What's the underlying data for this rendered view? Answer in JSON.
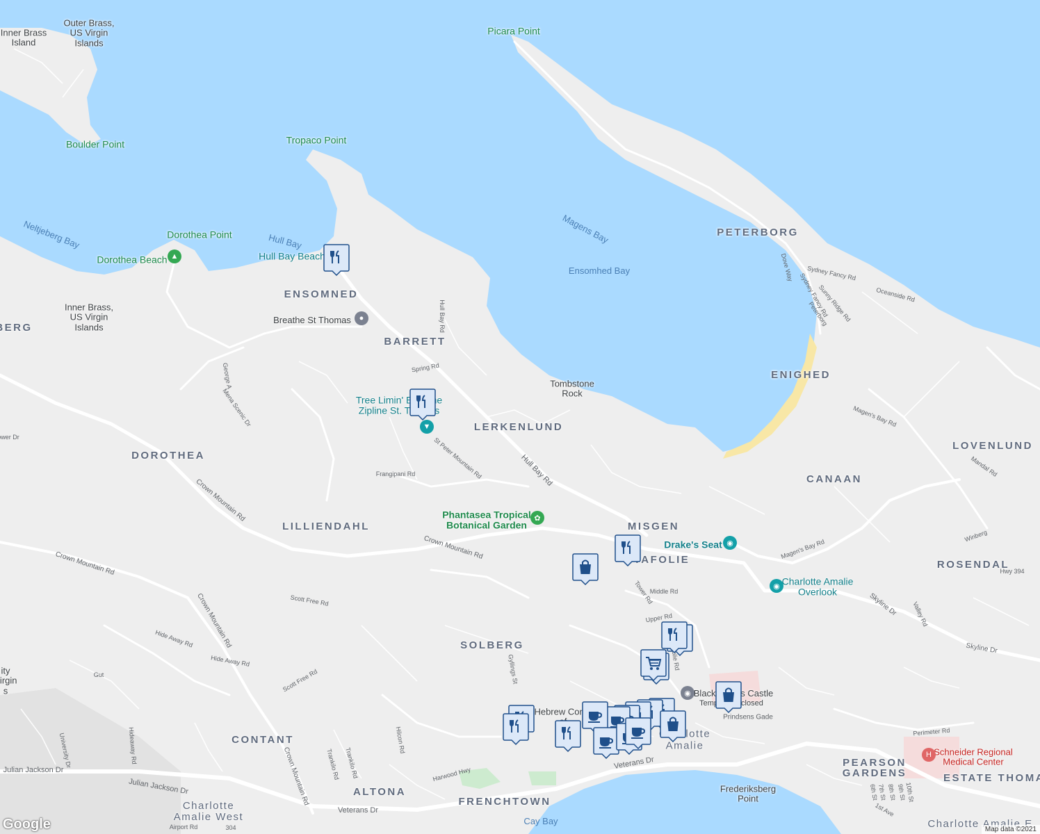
{
  "colors": {
    "water": "#aadaff",
    "land": "#eeeeee",
    "road": "#ffffff",
    "beach": "#f8e7a6",
    "pin": "#1f4f8a",
    "pin_fill": "#dce8f8"
  },
  "attribution": "Map data ©2021",
  "logo": "Google",
  "areas": {
    "peterborg": "PETERBORG",
    "enighed": "ENIGHED",
    "lovenlund": "LOVENLUND",
    "canaan": "CANAAN",
    "rosendal": "ROSENDAL",
    "ensomned": "ENSOMNED",
    "barrett": "BARRETT",
    "lerkenlund": "LERKENLUND",
    "dorothea": "DOROTHEA",
    "lilliendahl": "LILLIENDAHL",
    "misgen": "MISGEN",
    "tafolie": "TAFOLIE",
    "solberg": "SOLBERG",
    "contant": "CONTANT",
    "altona": "ALTONA",
    "frenchtown": "FRENCHTOWN",
    "pearson": "PEARSON",
    "gardens": "GARDENS",
    "estate_thomas": "ESTATE THOMA",
    "berg": "BERG",
    "charlotte_amalie_west_1": "Charlotte",
    "charlotte_amalie_west_2": "Amalie West",
    "charlotte_amalie_east": "Charlotte Amalie E"
  },
  "water_labels": {
    "magens_bay": "Magens Bay",
    "ensomhed_bay": "Ensomhed Bay",
    "neltjeberg_bay": "Neltjeberg Bay",
    "hull_bay": "Hull Bay",
    "cay_bay": "Cay Bay"
  },
  "places": {
    "inner_brass_top": "Inner Brass\nIsland",
    "outer_brass": "Outer Brass,\nUS Virgin\nIslands",
    "inner_brass": "Inner Brass,\nUS Virgin\nIslands",
    "picara_point": "Picara Point",
    "boulder_point": "Boulder Point",
    "tropaco_point": "Tropaco Point",
    "dorothea_point": "Dorothea Point",
    "dorothea_beach": "Dorothea Beach",
    "hull_bay_beach": "Hull Bay Beach",
    "breathe": "Breathe St Thomas",
    "tombstone": "Tombstone\nRock",
    "tree_limin": "Tree Limin' Extreme\nZipline St. Thomas",
    "phantasea": "Phantasea Tropical\nBotanical Garden",
    "drakes_seat": "Drake's Seat",
    "ca_overlook": "Charlotte Amalie\nOverlook",
    "blackbeards": "Blackbeard's Castle",
    "temp_closed": "Temporarily closed",
    "hebrew": "Hebrew Cong.\nof",
    "charlotte_amalie": "Charlotte\nAmalie",
    "frederiksberg": "Frederiksberg\nPoint",
    "schneider": "Schneider Regional\nMedical Center",
    "university": "ity\nVirgin\ns"
  },
  "streets": {
    "hull_bay_rd_1": "Hull Bay Rd",
    "hull_bay_rd_2": "Hull Bay Rd",
    "spring_rd": "Spring Rd",
    "st_peter": "St Peter Mountain Rd",
    "frangipani": "Frangipani Rd",
    "crown_mtn_1": "Crown Mountain Rd",
    "crown_mtn_2": "Crown Mountain Rd",
    "crown_mtn_3": "Crown Mountain Rd",
    "crown_mtn_4": "Crown Mountain Rd",
    "crown_mtn_5": "Crown Mountain Rd",
    "mena": "Mena Scenic Dr",
    "george": "George A",
    "ower": "ower Dr",
    "scott_free_1": "Scott Free Rd",
    "scott_free_2": "Scott Free Rd",
    "hide_away_1": "Hide Away Rd",
    "hide_away_2": "Hide Away Rd",
    "gut": "Gut",
    "hideaway_rd": "Hideaway Rd",
    "university_dr": "University Dr",
    "julian_1": "Julian Jackson Dr",
    "julian_2": "Julian Jackson Dr",
    "airport": "Airport Rd",
    "r304": "304",
    "veterans_1": "Veterans Dr",
    "veterans_2": "Veterans Dr",
    "harwood": "Harwood Hwy",
    "hilcon": "Hilcon Rd",
    "frankio_1": "Trankilo Rd",
    "frankio_2": "Trankilo Rd",
    "gyllings": "Gyllings St",
    "tower": "Tower Rd",
    "middle": "Middle Rd",
    "upper": "Upper Rd",
    "tafolie_rd": "Tafolie Rd",
    "magens_1": "Magen's Bay Rd",
    "magens_2": "Magen's Bay Rd",
    "skyline_1": "Skyline Dr",
    "skyline_2": "Skyline Dr",
    "valley": "Valley Rd",
    "hwy394": "Hwy 394",
    "winberg": "Winberg",
    "mandal": "Mandal Rd",
    "dove": "Dove Way",
    "sydney_1": "Sydney Fancy Rd",
    "sydney_2": "Sydney Fancy Rd",
    "sunny": "Sunny Ridge Rd",
    "peterborg_rd": "Peterborg",
    "oceanside": "Oceanside Rd",
    "prindsens": "Prindsens Gade",
    "perimeter": "Perimeter Rd",
    "ave_6": "6th St",
    "ave_7": "7th St",
    "ave_8": "8th St",
    "ave_9": "9th St",
    "ave_10": "10th St",
    "first_ave": "1st Ave"
  },
  "pins": {
    "restaurant": "restaurant-pin",
    "shopping": "shopping-pin",
    "cafe": "cafe-pin",
    "grocery": "grocery-pin"
  }
}
